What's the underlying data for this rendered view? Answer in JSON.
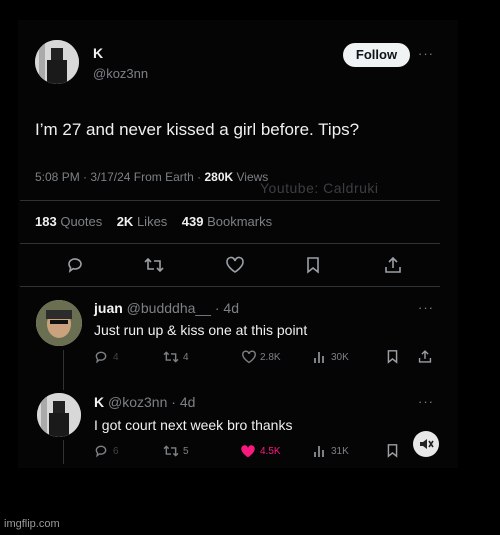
{
  "main_tweet": {
    "display_name": "K",
    "handle": "@koz3nn",
    "follow_label": "Follow",
    "more": "···",
    "text": "I’m 27 and never kissed a girl before. Tips?",
    "time": "5:08 PM",
    "date": "3/17/24",
    "source": "From Earth",
    "views_count": "280K",
    "views_label": "Views",
    "stats": {
      "quotes_count": "183",
      "quotes_label": "Quotes",
      "likes_count": "2K",
      "likes_label": "Likes",
      "bookmarks_count": "439",
      "bookmarks_label": "Bookmarks"
    }
  },
  "watermark": "Youtube: Caldruki",
  "replies": [
    {
      "display_name": "juan",
      "handle": "@budddha__",
      "age": "4d",
      "text": "Just run up & kiss one at this point",
      "reply_count": "4",
      "retweet_count": "4",
      "like_count": "2.8K",
      "view_count": "30K"
    },
    {
      "display_name": "K",
      "handle": "@koz3nn",
      "age": "4d",
      "text": "I got court next week bro thanks",
      "reply_count": "6",
      "retweet_count": "5",
      "like_count": "4.5K",
      "view_count": "31K"
    }
  ],
  "colors": {
    "background": "#000000",
    "text": "#e7e9ea",
    "muted": "#7c8186",
    "like_active": "#f91880"
  },
  "footer": "imgflip.com"
}
